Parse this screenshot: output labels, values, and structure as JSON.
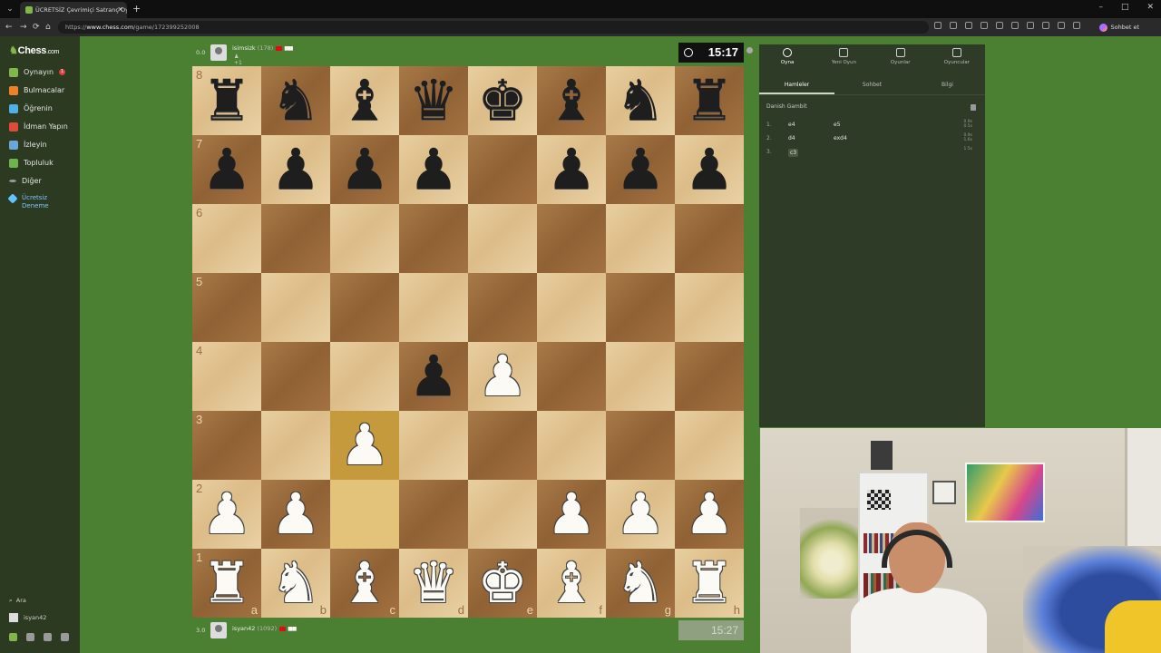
{
  "browser": {
    "tab_title": "ÜCRETSİZ Çevrimiçi Satranç Oy",
    "url_prefix": "https://",
    "url_domain": "www.chess.com",
    "url_path": "/game/172399252008",
    "profile_label": "Sohbet et",
    "window_controls": [
      "–",
      "□",
      "✕"
    ],
    "back": "←",
    "forward": "→",
    "reload": "⟳",
    "home": "⌂"
  },
  "sidebar": {
    "logo": "Chess",
    "logo_suffix": ".com",
    "items": [
      {
        "label": "Oynayın",
        "badge": "1",
        "color": "#81b64c"
      },
      {
        "label": "Bulmacalar",
        "color": "#f07f2a"
      },
      {
        "label": "Öğrenin",
        "color": "#4fb0e8"
      },
      {
        "label": "İdman Yapın",
        "color": "#e04a3a"
      },
      {
        "label": "İzleyin",
        "color": "#6aa6d8"
      },
      {
        "label": "Topluluk",
        "color": "#6fb34f"
      },
      {
        "label": "Diğer",
        "color": "#9a9a9a"
      }
    ],
    "trial": [
      "Ücretsiz",
      "Deneme"
    ],
    "search_label": "Ara",
    "user_label": "isyan42"
  },
  "top_player": {
    "score": "0.0",
    "name": "isimsizk",
    "rating": "(178)",
    "captured": "+1",
    "clock": "15:17"
  },
  "bottom_player": {
    "score": "3.0",
    "name": "isyan42",
    "rating": "(1092)",
    "clock": "15:27"
  },
  "board": {
    "ranks": [
      "8",
      "7",
      "6",
      "5",
      "4",
      "3",
      "2",
      "1"
    ],
    "files": [
      "a",
      "b",
      "c",
      "d",
      "e",
      "f",
      "g",
      "h"
    ],
    "highlight": [
      "c2",
      "c3"
    ],
    "position": [
      [
        "br",
        "bn",
        "bb",
        "bq",
        "bk",
        "bb",
        "bn",
        "br"
      ],
      [
        "bp",
        "bp",
        "bp",
        "bp",
        "",
        "bp",
        "bp",
        "bp"
      ],
      [
        "",
        "",
        "",
        "",
        "",
        "",
        "",
        ""
      ],
      [
        "",
        "",
        "",
        "",
        "",
        "",
        "",
        ""
      ],
      [
        "",
        "",
        "",
        "bp",
        "wp",
        "",
        "",
        ""
      ],
      [
        "",
        "",
        "wp",
        "",
        "",
        "",
        "",
        ""
      ],
      [
        "wp",
        "wp",
        "",
        "",
        "",
        "wp",
        "wp",
        "wp"
      ],
      [
        "wr",
        "wn",
        "wb",
        "wq",
        "wk",
        "wb",
        "wn",
        "wr"
      ]
    ]
  },
  "panel": {
    "tabs": [
      "Oyna",
      "Yeni Oyun",
      "Oyunlar",
      "Oyuncular"
    ],
    "subtabs": [
      "Hamleler",
      "Sohbet",
      "Bilgi"
    ],
    "opening": "Danish Gambit",
    "moves": [
      {
        "num": "1.",
        "white": "e4",
        "black": "e5",
        "t1": "0.9s",
        "t2": "0.5s"
      },
      {
        "num": "2.",
        "white": "d4",
        "black": "exd4",
        "t1": "0.9s",
        "t2": "1.6s"
      },
      {
        "num": "3.",
        "white": "c3",
        "black": "",
        "t1": "1.5s",
        "t2": ""
      }
    ]
  }
}
